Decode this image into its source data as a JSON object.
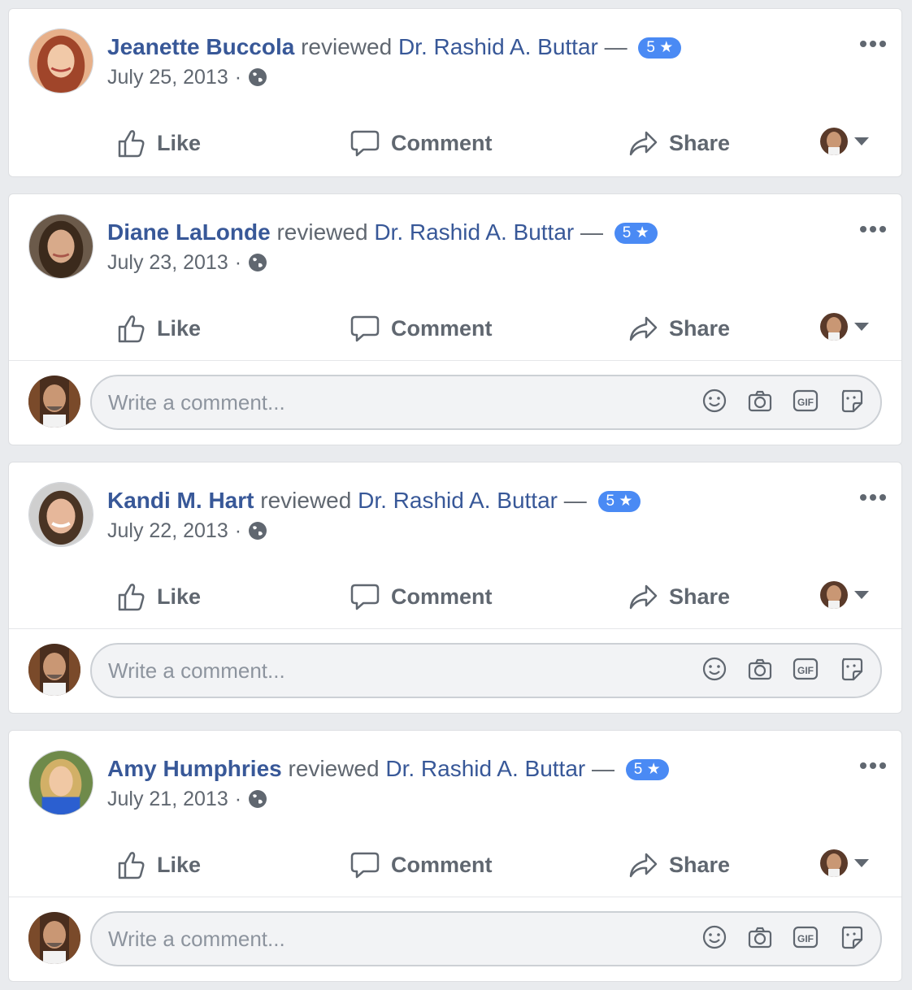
{
  "reviews": [
    {
      "reviewer": "Jeanette Buccola",
      "verb": "reviewed",
      "page": "Dr. Rashid A. Buttar",
      "dash": "—",
      "rating": "5",
      "date": "July 25, 2013",
      "dot": "·",
      "avatar": {
        "bg": "#e7b08a",
        "hair": "#a0452a",
        "skin": "#f1c9a8"
      }
    },
    {
      "reviewer": "Diane LaLonde",
      "verb": "reviewed",
      "page": "Dr. Rashid A. Buttar",
      "dash": "—",
      "rating": "5",
      "date": "July 23, 2013",
      "dot": "·",
      "avatar": {
        "bg": "#6b5a4a",
        "hair": "#3b2a1c",
        "skin": "#d8aa8a"
      }
    },
    {
      "reviewer": "Kandi M. Hart",
      "verb": "reviewed",
      "page": "Dr. Rashid A. Buttar",
      "dash": "—",
      "rating": "5",
      "date": "July 22, 2013",
      "dot": "·",
      "avatar": {
        "bg": "#cfcfcf",
        "hair": "#4a3424",
        "skin": "#e6b79a"
      }
    },
    {
      "reviewer": "Amy Humphries",
      "verb": "reviewed",
      "page": "Dr. Rashid A. Buttar",
      "dash": "—",
      "rating": "5",
      "date": "July 21, 2013",
      "dot": "·",
      "avatar": {
        "bg": "#6f8a4a",
        "hair": "#d2b067",
        "skin": "#f0c8a4"
      }
    }
  ],
  "actions": {
    "like": "Like",
    "comment": "Comment",
    "share": "Share"
  },
  "composer": {
    "placeholder": "Write a comment..."
  },
  "colors": {
    "link": "#385898",
    "badge": "#4a8af4",
    "muted": "#606770",
    "background": "#e9ebee"
  },
  "icons": [
    "globe-icon",
    "more-options-icon",
    "like-icon",
    "comment-icon",
    "share-icon",
    "emoji-icon",
    "camera-icon",
    "gif-icon",
    "sticker-icon"
  ]
}
